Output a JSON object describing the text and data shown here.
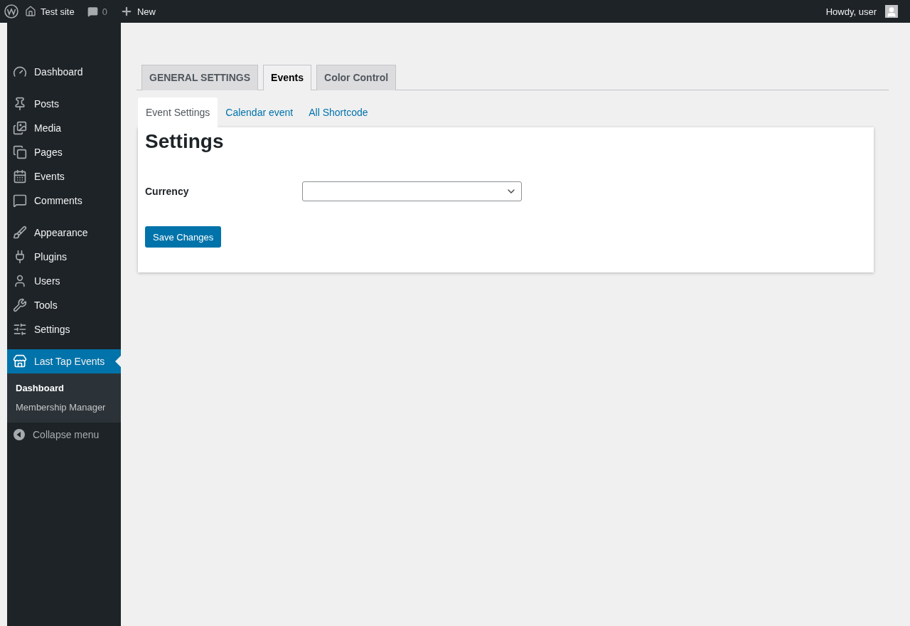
{
  "admin_bar": {
    "site_name": "Test site",
    "comment_count": "0",
    "new_label": "New",
    "greeting": "Howdy, user"
  },
  "sidebar": {
    "groups": [
      [
        {
          "label": "Dashboard",
          "selected": false
        }
      ],
      [
        {
          "label": "Posts",
          "selected": false
        },
        {
          "label": "Media",
          "selected": false
        },
        {
          "label": "Pages",
          "selected": false
        },
        {
          "label": "Events",
          "selected": false
        },
        {
          "label": "Comments",
          "selected": false
        }
      ],
      [
        {
          "label": "Appearance",
          "selected": false
        },
        {
          "label": "Plugins",
          "selected": false
        },
        {
          "label": "Users",
          "selected": false
        },
        {
          "label": "Tools",
          "selected": false
        },
        {
          "label": "Settings",
          "selected": false
        }
      ],
      [
        {
          "label": "Last Tap Events",
          "selected": true
        }
      ]
    ],
    "submenu": [
      {
        "label": "Dashboard",
        "selected": true
      },
      {
        "label": "Membership Manager",
        "selected": false
      }
    ],
    "collapse_label": "Collapse menu"
  },
  "tabs": [
    {
      "label": "GENERAL SETTINGS",
      "selected": false
    },
    {
      "label": "Events",
      "selected": true
    },
    {
      "label": "Color Control",
      "selected": false
    }
  ],
  "sub_tabs": [
    {
      "label": "Event Settings",
      "selected": true
    },
    {
      "label": "Calendar event",
      "selected": false
    },
    {
      "label": "All Shortcode",
      "selected": false
    }
  ],
  "panel": {
    "title": "Settings",
    "fields": [
      {
        "label": "Currency",
        "kind": "select"
      }
    ],
    "save_button": "Save Changes"
  }
}
